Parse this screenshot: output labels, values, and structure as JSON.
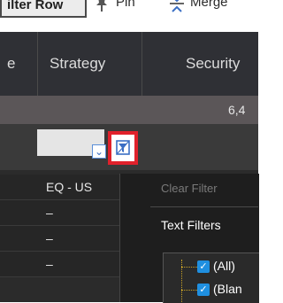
{
  "toolbar": {
    "filter_row_label": "ilter Row",
    "pin_label": "Pin",
    "merge_label": "Merge"
  },
  "columns": [
    {
      "label": "e"
    },
    {
      "label": "Strategy"
    },
    {
      "label": "Security"
    }
  ],
  "totals": {
    "security_value": "6,4"
  },
  "filter_row": {
    "dropdown_glyph": "⌄"
  },
  "rows": [
    {
      "strategy": "EQ - US"
    },
    {
      "strategy": "–"
    },
    {
      "strategy": "–"
    },
    {
      "strategy": "–"
    }
  ],
  "filter_popup": {
    "clear_filter": "Clear Filter",
    "text_filters": "Text Filters",
    "items": [
      {
        "label": "(All)",
        "checked": true
      },
      {
        "label": "(Blan",
        "checked": true
      }
    ]
  },
  "colors": {
    "highlight": "#e0212b",
    "checkbox": "#1f8fe0"
  }
}
